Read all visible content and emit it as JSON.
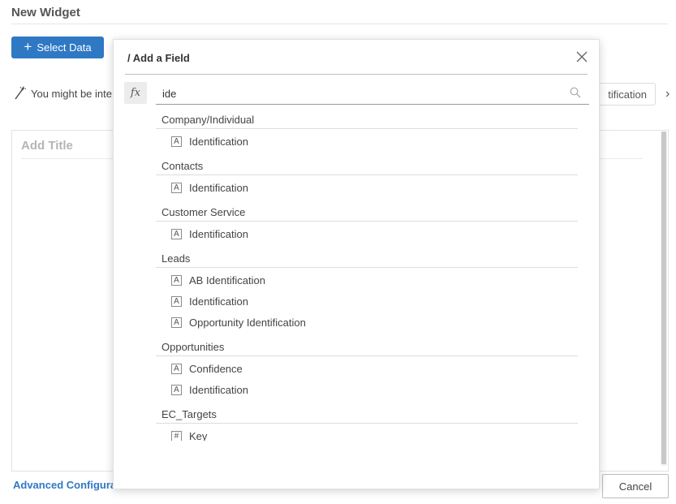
{
  "page": {
    "title": "New Widget",
    "select_data_label": "Select Data",
    "suggestion_text": "You might be inte",
    "suggestion_chip_text": "tification",
    "add_title_placeholder": "Add Title",
    "advanced_configuration_label": "Advanced Configuration",
    "cancel_label": "Cancel"
  },
  "modal": {
    "title": "/ Add a Field",
    "fx_label": "fx",
    "search": {
      "value": "ide",
      "placeholder": ""
    },
    "groups": [
      {
        "name": "Company/Individual",
        "fields": [
          {
            "type": "A",
            "label": "Identification"
          }
        ]
      },
      {
        "name": "Contacts",
        "fields": [
          {
            "type": "A",
            "label": "Identification"
          }
        ]
      },
      {
        "name": "Customer Service",
        "fields": [
          {
            "type": "A",
            "label": "Identification"
          }
        ]
      },
      {
        "name": "Leads",
        "fields": [
          {
            "type": "A",
            "label": "AB Identification"
          },
          {
            "type": "A",
            "label": "Identification"
          },
          {
            "type": "A",
            "label": "Opportunity Identification"
          }
        ]
      },
      {
        "name": "Opportunities",
        "fields": [
          {
            "type": "A",
            "label": "Confidence"
          },
          {
            "type": "A",
            "label": "Identification"
          }
        ]
      },
      {
        "name": "EC_Targets",
        "fields": [
          {
            "type": "#",
            "label": "Key"
          }
        ]
      }
    ]
  },
  "colors": {
    "primary": "#2f78c4",
    "muted_text": "#b5b5b5"
  }
}
